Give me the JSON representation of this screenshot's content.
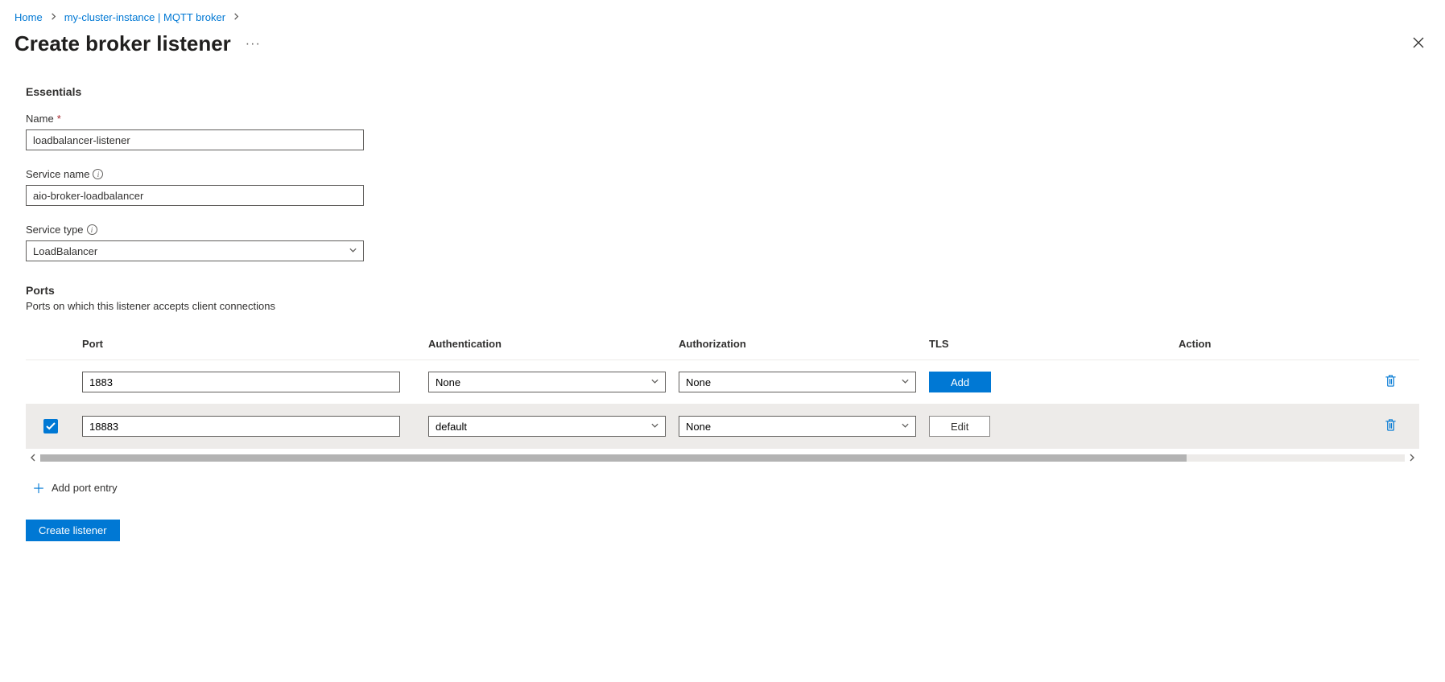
{
  "breadcrumb": {
    "home": "Home",
    "instance": "my-cluster-instance | MQTT broker"
  },
  "page": {
    "title": "Create broker listener"
  },
  "essentials": {
    "header": "Essentials",
    "name_label": "Name",
    "name_value": "loadbalancer-listener",
    "service_name_label": "Service name",
    "service_name_value": "aio-broker-loadbalancer",
    "service_type_label": "Service type",
    "service_type_value": "LoadBalancer"
  },
  "ports": {
    "header": "Ports",
    "description": "Ports on which this listener accepts client connections",
    "columns": {
      "port": "Port",
      "auth": "Authentication",
      "authz": "Authorization",
      "tls": "TLS",
      "action": "Action"
    },
    "rows": [
      {
        "port": "1883",
        "auth": "None",
        "authz": "None",
        "tls_button": "Add",
        "selected": false
      },
      {
        "port": "18883",
        "auth": "default",
        "authz": "None",
        "tls_button": "Edit",
        "selected": true
      }
    ],
    "add_entry_label": "Add port entry"
  },
  "footer": {
    "create_button": "Create listener"
  }
}
